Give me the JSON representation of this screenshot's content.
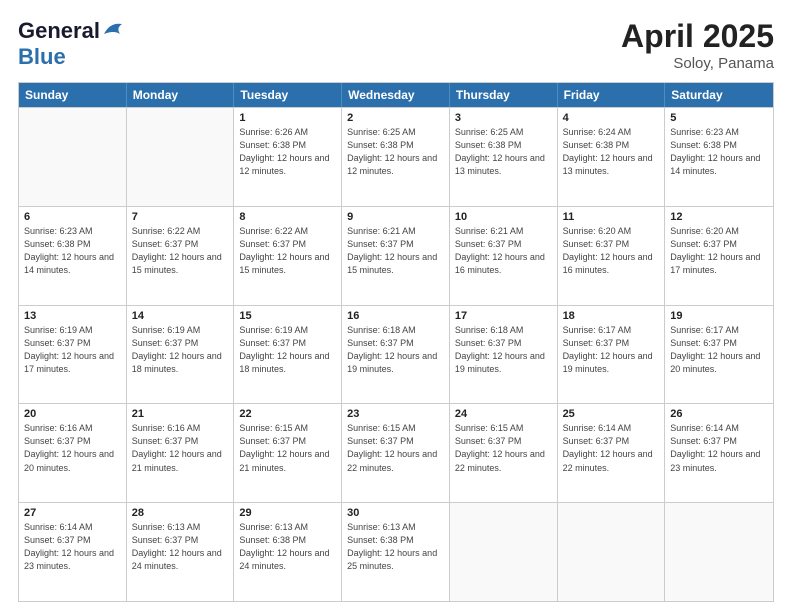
{
  "header": {
    "logo_line1": "General",
    "logo_line2": "Blue",
    "month": "April 2025",
    "location": "Soloy, Panama"
  },
  "days_of_week": [
    "Sunday",
    "Monday",
    "Tuesday",
    "Wednesday",
    "Thursday",
    "Friday",
    "Saturday"
  ],
  "weeks": [
    [
      {
        "day": "",
        "info": ""
      },
      {
        "day": "",
        "info": ""
      },
      {
        "day": "1",
        "info": "Sunrise: 6:26 AM\nSunset: 6:38 PM\nDaylight: 12 hours and 12 minutes."
      },
      {
        "day": "2",
        "info": "Sunrise: 6:25 AM\nSunset: 6:38 PM\nDaylight: 12 hours and 12 minutes."
      },
      {
        "day": "3",
        "info": "Sunrise: 6:25 AM\nSunset: 6:38 PM\nDaylight: 12 hours and 13 minutes."
      },
      {
        "day": "4",
        "info": "Sunrise: 6:24 AM\nSunset: 6:38 PM\nDaylight: 12 hours and 13 minutes."
      },
      {
        "day": "5",
        "info": "Sunrise: 6:23 AM\nSunset: 6:38 PM\nDaylight: 12 hours and 14 minutes."
      }
    ],
    [
      {
        "day": "6",
        "info": "Sunrise: 6:23 AM\nSunset: 6:38 PM\nDaylight: 12 hours and 14 minutes."
      },
      {
        "day": "7",
        "info": "Sunrise: 6:22 AM\nSunset: 6:37 PM\nDaylight: 12 hours and 15 minutes."
      },
      {
        "day": "8",
        "info": "Sunrise: 6:22 AM\nSunset: 6:37 PM\nDaylight: 12 hours and 15 minutes."
      },
      {
        "day": "9",
        "info": "Sunrise: 6:21 AM\nSunset: 6:37 PM\nDaylight: 12 hours and 15 minutes."
      },
      {
        "day": "10",
        "info": "Sunrise: 6:21 AM\nSunset: 6:37 PM\nDaylight: 12 hours and 16 minutes."
      },
      {
        "day": "11",
        "info": "Sunrise: 6:20 AM\nSunset: 6:37 PM\nDaylight: 12 hours and 16 minutes."
      },
      {
        "day": "12",
        "info": "Sunrise: 6:20 AM\nSunset: 6:37 PM\nDaylight: 12 hours and 17 minutes."
      }
    ],
    [
      {
        "day": "13",
        "info": "Sunrise: 6:19 AM\nSunset: 6:37 PM\nDaylight: 12 hours and 17 minutes."
      },
      {
        "day": "14",
        "info": "Sunrise: 6:19 AM\nSunset: 6:37 PM\nDaylight: 12 hours and 18 minutes."
      },
      {
        "day": "15",
        "info": "Sunrise: 6:19 AM\nSunset: 6:37 PM\nDaylight: 12 hours and 18 minutes."
      },
      {
        "day": "16",
        "info": "Sunrise: 6:18 AM\nSunset: 6:37 PM\nDaylight: 12 hours and 19 minutes."
      },
      {
        "day": "17",
        "info": "Sunrise: 6:18 AM\nSunset: 6:37 PM\nDaylight: 12 hours and 19 minutes."
      },
      {
        "day": "18",
        "info": "Sunrise: 6:17 AM\nSunset: 6:37 PM\nDaylight: 12 hours and 19 minutes."
      },
      {
        "day": "19",
        "info": "Sunrise: 6:17 AM\nSunset: 6:37 PM\nDaylight: 12 hours and 20 minutes."
      }
    ],
    [
      {
        "day": "20",
        "info": "Sunrise: 6:16 AM\nSunset: 6:37 PM\nDaylight: 12 hours and 20 minutes."
      },
      {
        "day": "21",
        "info": "Sunrise: 6:16 AM\nSunset: 6:37 PM\nDaylight: 12 hours and 21 minutes."
      },
      {
        "day": "22",
        "info": "Sunrise: 6:15 AM\nSunset: 6:37 PM\nDaylight: 12 hours and 21 minutes."
      },
      {
        "day": "23",
        "info": "Sunrise: 6:15 AM\nSunset: 6:37 PM\nDaylight: 12 hours and 22 minutes."
      },
      {
        "day": "24",
        "info": "Sunrise: 6:15 AM\nSunset: 6:37 PM\nDaylight: 12 hours and 22 minutes."
      },
      {
        "day": "25",
        "info": "Sunrise: 6:14 AM\nSunset: 6:37 PM\nDaylight: 12 hours and 22 minutes."
      },
      {
        "day": "26",
        "info": "Sunrise: 6:14 AM\nSunset: 6:37 PM\nDaylight: 12 hours and 23 minutes."
      }
    ],
    [
      {
        "day": "27",
        "info": "Sunrise: 6:14 AM\nSunset: 6:37 PM\nDaylight: 12 hours and 23 minutes."
      },
      {
        "day": "28",
        "info": "Sunrise: 6:13 AM\nSunset: 6:37 PM\nDaylight: 12 hours and 24 minutes."
      },
      {
        "day": "29",
        "info": "Sunrise: 6:13 AM\nSunset: 6:38 PM\nDaylight: 12 hours and 24 minutes."
      },
      {
        "day": "30",
        "info": "Sunrise: 6:13 AM\nSunset: 6:38 PM\nDaylight: 12 hours and 25 minutes."
      },
      {
        "day": "",
        "info": ""
      },
      {
        "day": "",
        "info": ""
      },
      {
        "day": "",
        "info": ""
      }
    ]
  ]
}
